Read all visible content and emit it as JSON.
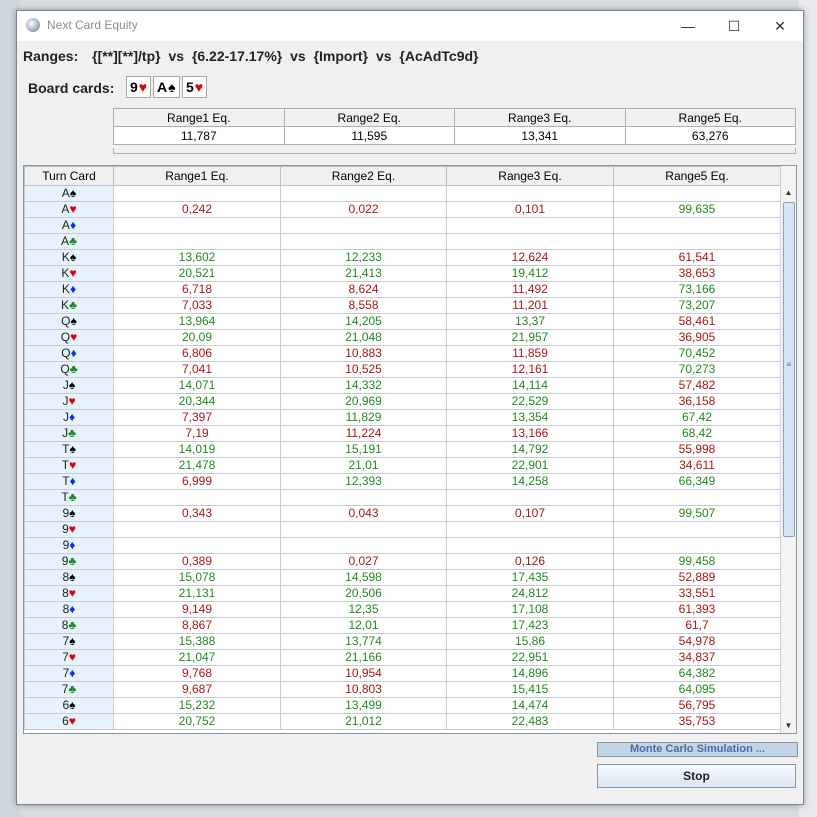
{
  "window": {
    "title": "Next Card Equity",
    "controls": {
      "minimize": "—",
      "maximize": "☐",
      "close": "✕"
    }
  },
  "ranges": {
    "label": "Ranges:",
    "r1": "{[**][**]/tp}",
    "vs1": "vs",
    "r2": "{6.22-17.17%}",
    "vs2": "vs",
    "r3": "{Import}",
    "vs3": "vs",
    "r5": "{AcAdTc9d}"
  },
  "board": {
    "label": "Board cards:",
    "cards": [
      {
        "rank": "9",
        "suit": "♥",
        "color": "#e00000"
      },
      {
        "rank": "A",
        "suit": "♠",
        "color": "#000000"
      },
      {
        "rank": "5",
        "suit": "♥",
        "color": "#e00000"
      }
    ]
  },
  "summary": {
    "headers": [
      "Range1 Eq.",
      "Range2 Eq.",
      "Range3 Eq.",
      "Range5 Eq."
    ],
    "values": [
      "11,787",
      "11,595",
      "13,341",
      "63,276"
    ]
  },
  "grid": {
    "headers": [
      "Turn Card",
      "Range1 Eq.",
      "Range2 Eq.",
      "Range3 Eq.",
      "Range5 Eq."
    ],
    "suit_colors": {
      "♠": "#000000",
      "♥": "#e00000",
      "♦": "#0033ee",
      "♣": "#1a8a1a"
    },
    "rows": [
      {
        "rank": "A",
        "suit": "♠",
        "vals": [
          "",
          "",
          "",
          ""
        ],
        "colors": [
          "",
          "",
          "",
          ""
        ]
      },
      {
        "rank": "A",
        "suit": "♥",
        "vals": [
          "0,242",
          "0,022",
          "0,101",
          "99,635"
        ],
        "colors": [
          "red",
          "red",
          "red",
          "green"
        ]
      },
      {
        "rank": "A",
        "suit": "♦",
        "vals": [
          "",
          "",
          "",
          ""
        ],
        "colors": [
          "",
          "",
          "",
          ""
        ]
      },
      {
        "rank": "A",
        "suit": "♣",
        "vals": [
          "",
          "",
          "",
          ""
        ],
        "colors": [
          "",
          "",
          "",
          ""
        ]
      },
      {
        "rank": "K",
        "suit": "♠",
        "vals": [
          "13,602",
          "12,233",
          "12,624",
          "61,541"
        ],
        "colors": [
          "green",
          "green",
          "red",
          "red"
        ]
      },
      {
        "rank": "K",
        "suit": "♥",
        "vals": [
          "20,521",
          "21,413",
          "19,412",
          "38,653"
        ],
        "colors": [
          "green",
          "green",
          "green",
          "red"
        ]
      },
      {
        "rank": "K",
        "suit": "♦",
        "vals": [
          "6,718",
          "8,624",
          "11,492",
          "73,166"
        ],
        "colors": [
          "red",
          "red",
          "red",
          "green"
        ]
      },
      {
        "rank": "K",
        "suit": "♣",
        "vals": [
          "7,033",
          "8,558",
          "11,201",
          "73,207"
        ],
        "colors": [
          "red",
          "red",
          "red",
          "green"
        ]
      },
      {
        "rank": "Q",
        "suit": "♠",
        "vals": [
          "13,964",
          "14,205",
          "13,37",
          "58,461"
        ],
        "colors": [
          "green",
          "green",
          "green",
          "red"
        ]
      },
      {
        "rank": "Q",
        "suit": "♥",
        "vals": [
          "20,09",
          "21,048",
          "21,957",
          "36,905"
        ],
        "colors": [
          "green",
          "green",
          "green",
          "red"
        ]
      },
      {
        "rank": "Q",
        "suit": "♦",
        "vals": [
          "6,806",
          "10,883",
          "11,859",
          "70,452"
        ],
        "colors": [
          "red",
          "red",
          "red",
          "green"
        ]
      },
      {
        "rank": "Q",
        "suit": "♣",
        "vals": [
          "7,041",
          "10,525",
          "12,161",
          "70,273"
        ],
        "colors": [
          "red",
          "red",
          "red",
          "green"
        ]
      },
      {
        "rank": "J",
        "suit": "♠",
        "vals": [
          "14,071",
          "14,332",
          "14,114",
          "57,482"
        ],
        "colors": [
          "green",
          "green",
          "green",
          "red"
        ]
      },
      {
        "rank": "J",
        "suit": "♥",
        "vals": [
          "20,344",
          "20,969",
          "22,529",
          "36,158"
        ],
        "colors": [
          "green",
          "green",
          "green",
          "red"
        ]
      },
      {
        "rank": "J",
        "suit": "♦",
        "vals": [
          "7,397",
          "11,829",
          "13,354",
          "67,42"
        ],
        "colors": [
          "red",
          "green",
          "green",
          "green"
        ]
      },
      {
        "rank": "J",
        "suit": "♣",
        "vals": [
          "7,19",
          "11,224",
          "13,166",
          "68,42"
        ],
        "colors": [
          "red",
          "red",
          "red",
          "green"
        ]
      },
      {
        "rank": "T",
        "suit": "♠",
        "vals": [
          "14,019",
          "15,191",
          "14,792",
          "55,998"
        ],
        "colors": [
          "green",
          "green",
          "green",
          "red"
        ]
      },
      {
        "rank": "T",
        "suit": "♥",
        "vals": [
          "21,478",
          "21,01",
          "22,901",
          "34,611"
        ],
        "colors": [
          "green",
          "green",
          "green",
          "red"
        ]
      },
      {
        "rank": "T",
        "suit": "♦",
        "vals": [
          "6,999",
          "12,393",
          "14,258",
          "66,349"
        ],
        "colors": [
          "red",
          "green",
          "green",
          "green"
        ]
      },
      {
        "rank": "T",
        "suit": "♣",
        "vals": [
          "",
          "",
          "",
          ""
        ],
        "colors": [
          "",
          "",
          "",
          ""
        ]
      },
      {
        "rank": "9",
        "suit": "♠",
        "vals": [
          "0,343",
          "0,043",
          "0,107",
          "99,507"
        ],
        "colors": [
          "red",
          "red",
          "red",
          "green"
        ]
      },
      {
        "rank": "9",
        "suit": "♥",
        "vals": [
          "",
          "",
          "",
          ""
        ],
        "colors": [
          "",
          "",
          "",
          ""
        ]
      },
      {
        "rank": "9",
        "suit": "♦",
        "vals": [
          "",
          "",
          "",
          ""
        ],
        "colors": [
          "",
          "",
          "",
          ""
        ]
      },
      {
        "rank": "9",
        "suit": "♣",
        "vals": [
          "0,389",
          "0,027",
          "0,126",
          "99,458"
        ],
        "colors": [
          "red",
          "red",
          "red",
          "green"
        ]
      },
      {
        "rank": "8",
        "suit": "♠",
        "vals": [
          "15,078",
          "14,598",
          "17,435",
          "52,889"
        ],
        "colors": [
          "green",
          "green",
          "green",
          "red"
        ]
      },
      {
        "rank": "8",
        "suit": "♥",
        "vals": [
          "21,131",
          "20,506",
          "24,812",
          "33,551"
        ],
        "colors": [
          "green",
          "green",
          "green",
          "red"
        ]
      },
      {
        "rank": "8",
        "suit": "♦",
        "vals": [
          "9,149",
          "12,35",
          "17,108",
          "61,393"
        ],
        "colors": [
          "red",
          "green",
          "green",
          "red"
        ]
      },
      {
        "rank": "8",
        "suit": "♣",
        "vals": [
          "8,867",
          "12,01",
          "17,423",
          "61,7"
        ],
        "colors": [
          "red",
          "green",
          "green",
          "red"
        ]
      },
      {
        "rank": "7",
        "suit": "♠",
        "vals": [
          "15,388",
          "13,774",
          "15,86",
          "54,978"
        ],
        "colors": [
          "green",
          "green",
          "green",
          "red"
        ]
      },
      {
        "rank": "7",
        "suit": "♥",
        "vals": [
          "21,047",
          "21,166",
          "22,951",
          "34,837"
        ],
        "colors": [
          "green",
          "green",
          "green",
          "red"
        ]
      },
      {
        "rank": "7",
        "suit": "♦",
        "vals": [
          "9,768",
          "10,954",
          "14,896",
          "64,382"
        ],
        "colors": [
          "red",
          "red",
          "green",
          "green"
        ]
      },
      {
        "rank": "7",
        "suit": "♣",
        "vals": [
          "9,687",
          "10,803",
          "15,415",
          "64,095"
        ],
        "colors": [
          "red",
          "red",
          "green",
          "green"
        ]
      },
      {
        "rank": "6",
        "suit": "♠",
        "vals": [
          "15,232",
          "13,499",
          "14,474",
          "56,795"
        ],
        "colors": [
          "green",
          "green",
          "green",
          "red"
        ]
      },
      {
        "rank": "6",
        "suit": "♥",
        "vals": [
          "20,752",
          "21,012",
          "22,483",
          "35,753"
        ],
        "colors": [
          "green",
          "green",
          "green",
          "red"
        ]
      }
    ]
  },
  "progress": {
    "label": "Monte Carlo Simulation ..."
  },
  "stop_button": {
    "label": "Stop"
  }
}
